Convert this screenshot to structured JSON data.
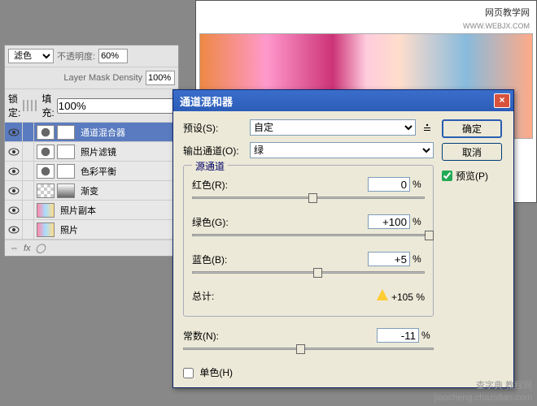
{
  "banner": {
    "site": "网页教学网",
    "url": "WWW.WEBJX.COM"
  },
  "layersPanel": {
    "blendMode": "滤色",
    "opacityLabel": "不透明度:",
    "opacityValue": "60%",
    "densityLabel": "Layer Mask Density",
    "densityValue": "100%",
    "lockLabel": "锁定:",
    "fillLabel": "填充:",
    "fillValue": "100%",
    "layers": [
      {
        "name": "通道混合器",
        "selected": true,
        "thumbs": [
          "circ",
          "mask"
        ]
      },
      {
        "name": "照片滤镜",
        "thumbs": [
          "circ",
          "mask"
        ]
      },
      {
        "name": "色彩平衡",
        "thumbs": [
          "circ",
          "mask"
        ]
      },
      {
        "name": "渐变",
        "thumbs": [
          "checker",
          "grad"
        ]
      },
      {
        "name": "照片副本",
        "thumbs": [
          "photo"
        ]
      },
      {
        "name": "照片",
        "thumbs": [
          "photo"
        ]
      }
    ]
  },
  "dialog": {
    "title": "通道混和器",
    "presetLabel": "预设(S):",
    "presetValue": "自定",
    "outputLabel": "输出通道(O):",
    "outputValue": "绿",
    "sourceLegend": "源通道",
    "channels": {
      "red": {
        "label": "红色(R):",
        "value": "0",
        "pos": 50
      },
      "green": {
        "label": "绿色(G):",
        "value": "+100",
        "pos": 100
      },
      "blue": {
        "label": "蓝色(B):",
        "value": "+5",
        "pos": 52
      }
    },
    "totalLabel": "总计:",
    "totalValue": "+105 %",
    "constant": {
      "label": "常数(N):",
      "value": "-11",
      "pos": 45
    },
    "mono": "单色(H)",
    "ok": "确定",
    "cancel": "取消",
    "preview": "预览(P)"
  },
  "watermark": {
    "line1": "查字典 教程网",
    "line2": "jiaocheng.chazidian.com"
  }
}
